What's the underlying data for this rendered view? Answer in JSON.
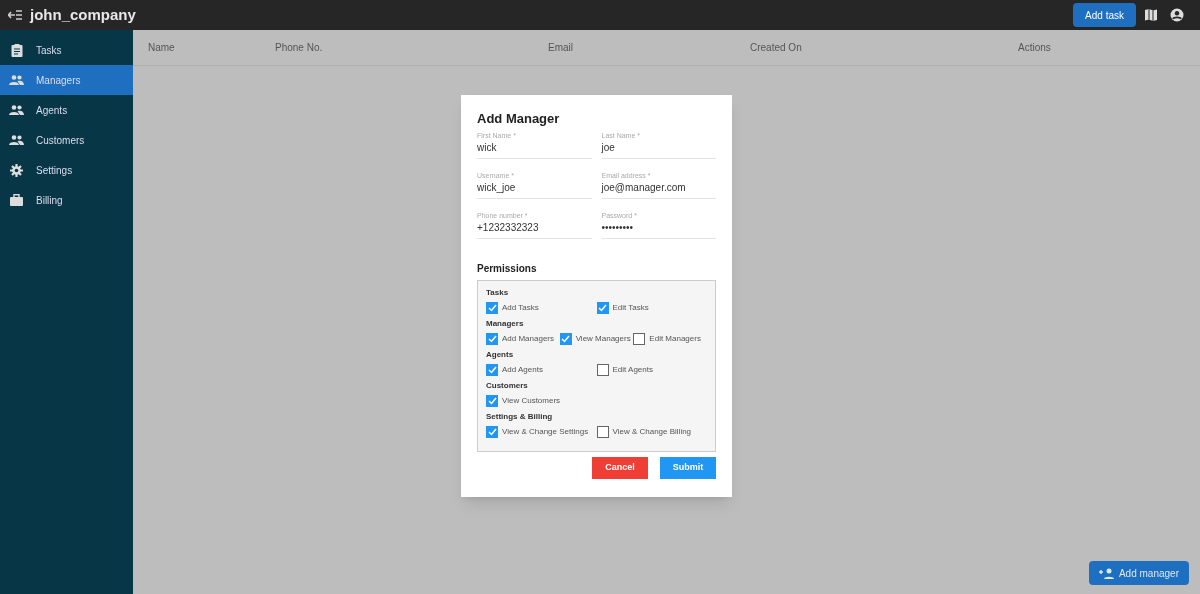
{
  "app_bar": {
    "title": "john_company",
    "add_task": "Add task"
  },
  "sidebar": {
    "items": [
      {
        "label": "Tasks",
        "selected": false
      },
      {
        "label": "Managers",
        "selected": true
      },
      {
        "label": "Agents",
        "selected": false
      },
      {
        "label": "Customers",
        "selected": false
      },
      {
        "label": "Settings",
        "selected": false
      },
      {
        "label": "Billing",
        "selected": false
      }
    ]
  },
  "table": {
    "columns": [
      "Name",
      "Phone No.",
      "Email",
      "Created On",
      "Actions"
    ]
  },
  "dialog": {
    "title": "Add Manager",
    "fields": [
      {
        "label": "First Name *",
        "value": "wick"
      },
      {
        "label": "Last Name *",
        "value": "joe"
      },
      {
        "label": "Username *",
        "value": "wick_joe"
      },
      {
        "label": "Email address *",
        "value": "joe@manager.com"
      },
      {
        "label": "Phone number *",
        "value": "+1232332323"
      },
      {
        "label": "Password *",
        "value": "•••••••••"
      }
    ],
    "permissions_title": "Permissions",
    "permission_groups": [
      {
        "title": "Tasks",
        "items": [
          {
            "label": "Add Tasks",
            "checked": true
          },
          {
            "label": "Edit Tasks",
            "checked": true
          }
        ]
      },
      {
        "title": "Managers",
        "items": [
          {
            "label": "Add Managers",
            "checked": true
          },
          {
            "label": "View Managers",
            "checked": true
          },
          {
            "label": "Edit Managers",
            "checked": false
          }
        ]
      },
      {
        "title": "Agents",
        "items": [
          {
            "label": "Add Agents",
            "checked": true
          },
          {
            "label": "Edit Agents",
            "checked": false
          }
        ]
      },
      {
        "title": "Customers",
        "items": [
          {
            "label": "View Customers",
            "checked": true
          }
        ]
      },
      {
        "title": "Settings & Billing",
        "items": [
          {
            "label": "View & Change Settings",
            "checked": true
          },
          {
            "label": "View & Change Billing",
            "checked": false
          }
        ]
      }
    ],
    "cancel": "Cancel",
    "submit": "Submit"
  },
  "fab": {
    "label": "Add manager"
  }
}
